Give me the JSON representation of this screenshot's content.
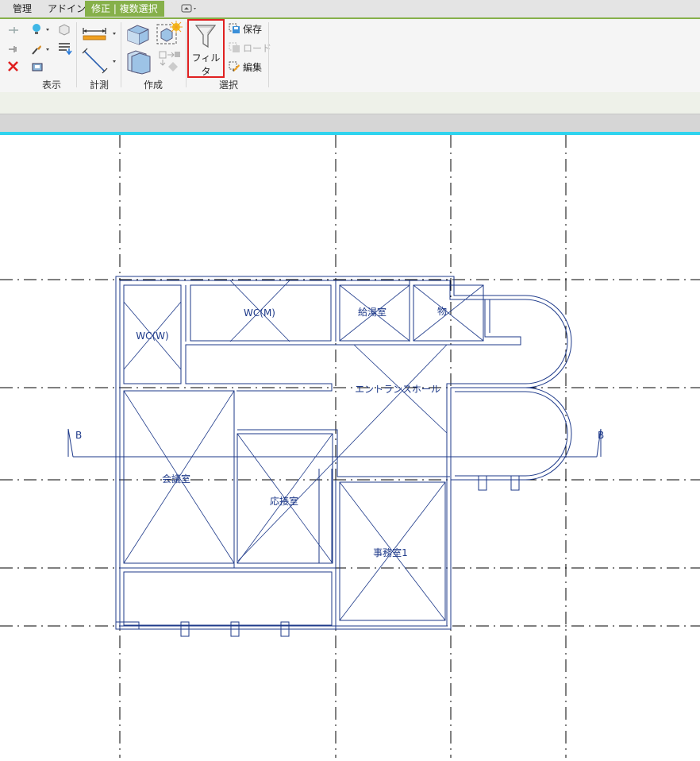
{
  "tabs": [
    {
      "label": "管理"
    },
    {
      "label": "アドイン"
    },
    {
      "label": "修正 | 複数選択",
      "active": true
    }
  ],
  "ribbon": {
    "panels": {
      "display": "表示",
      "measure": "計測",
      "create": "作成",
      "select": "選択"
    },
    "filter_label": "フィルタ",
    "select_buttons": {
      "save": "保存",
      "load": "ロード",
      "edit": "編集"
    }
  },
  "plan": {
    "rooms": {
      "wc_w": "WC(W)",
      "wc_m": "WC(M)",
      "kyutoshitsu": "給湯室",
      "mono": "物",
      "entrance": "エントランスホール",
      "kaigishitsu": "会議室",
      "osetsushitsu": "応接室",
      "jimushitsu": "事務室1"
    },
    "section_left": "B",
    "section_right": "B"
  },
  "colors": {
    "accent_tab": "#86b04a",
    "highlight": "#e02020",
    "view_border": "#2fd3ee",
    "model_lines": "#1e3a8a"
  }
}
